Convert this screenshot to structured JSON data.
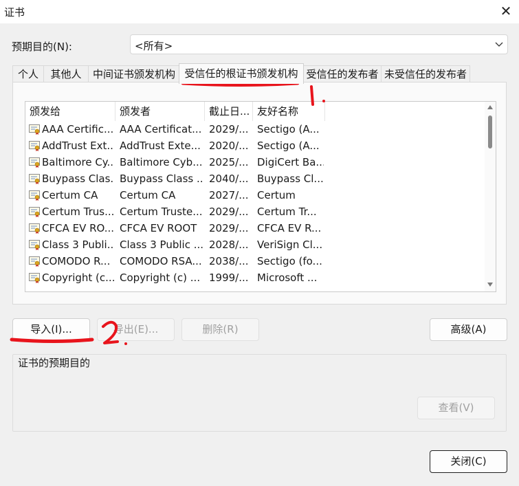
{
  "window": {
    "title": "证书",
    "close_glyph": "✕"
  },
  "purpose": {
    "label": "预期目的(N):",
    "selected": "<所有>"
  },
  "tabs": [
    {
      "label": "个人"
    },
    {
      "label": "其他人"
    },
    {
      "label": "中间证书颁发机构"
    },
    {
      "label": "受信任的根证书颁发机构",
      "active": true
    },
    {
      "label": "受信任的发布者"
    },
    {
      "label": "未受信任的发布者"
    }
  ],
  "list": {
    "columns": [
      "颁发给",
      "颁发者",
      "截止日...",
      "友好名称"
    ],
    "rows": [
      {
        "issued_to": "AAA Certific...",
        "issued_by": "AAA Certificat...",
        "expires": "2029/...",
        "friendly": "Sectigo (A..."
      },
      {
        "issued_to": "AddTrust Ext...",
        "issued_by": "AddTrust Exte...",
        "expires": "2020/...",
        "friendly": "Sectigo (A..."
      },
      {
        "issued_to": "Baltimore Cy...",
        "issued_by": "Baltimore Cyb...",
        "expires": "2025/...",
        "friendly": "DigiCert Ba..."
      },
      {
        "issued_to": "Buypass Clas...",
        "issued_by": "Buypass Class ...",
        "expires": "2040/...",
        "friendly": "Buypass Cl..."
      },
      {
        "issued_to": "Certum CA",
        "issued_by": "Certum CA",
        "expires": "2027/...",
        "friendly": "Certum"
      },
      {
        "issued_to": "Certum Trus...",
        "issued_by": "Certum Truste...",
        "expires": "2029/...",
        "friendly": "Certum Tr..."
      },
      {
        "issued_to": "CFCA EV RO...",
        "issued_by": "CFCA EV ROOT",
        "expires": "2029/...",
        "friendly": "CFCA EV R..."
      },
      {
        "issued_to": "Class 3 Publi...",
        "issued_by": "Class 3 Public ...",
        "expires": "2028/...",
        "friendly": "VeriSign Cl..."
      },
      {
        "issued_to": "COMODO R...",
        "issued_by": "COMODO RSA...",
        "expires": "2038/...",
        "friendly": "Sectigo (fo..."
      },
      {
        "issued_to": "Copyright (c...",
        "issued_by": "Copyright (c) ...",
        "expires": "1999/...",
        "friendly": "Microsoft ..."
      }
    ]
  },
  "buttons": {
    "import": "导入(I)...",
    "export": "导出(E)...",
    "remove": "删除(R)",
    "advanced": "高级(A)",
    "view": "查看(V)",
    "close": "关闭(C)"
  },
  "group": {
    "title": "证书的预期目的"
  },
  "annotations": {
    "mark_1": "1.",
    "mark_2": "2.",
    "color": "#e8141c"
  },
  "colors": {
    "accent": "#e8141c",
    "background": "#f0f0f0",
    "icon_border": "#8a8a8a"
  }
}
